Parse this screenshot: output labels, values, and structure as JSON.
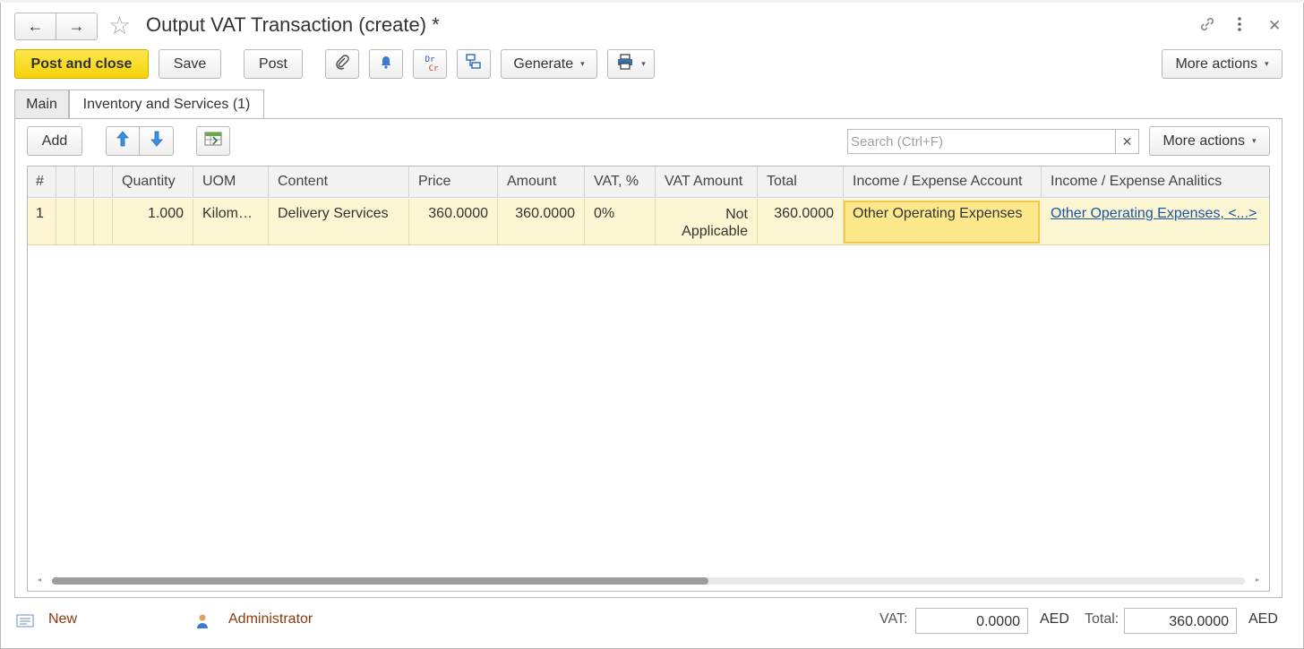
{
  "window": {
    "title": "Output VAT Transaction (create) *"
  },
  "toolbar": {
    "post_close": "Post and close",
    "save": "Save",
    "post": "Post",
    "drcr_top": "Dr",
    "drcr_bottom": "Cr",
    "generate": "Generate",
    "more_actions": "More actions"
  },
  "tabs": [
    {
      "label": "Main"
    },
    {
      "label": "Inventory and Services (1)"
    }
  ],
  "table_toolbar": {
    "add": "Add",
    "search_placeholder": "Search (Ctrl+F)",
    "more_actions": "More actions"
  },
  "table": {
    "columns": [
      "#",
      "",
      "",
      "Quantity",
      "UOM",
      "Content",
      "Price",
      "Amount",
      "VAT, %",
      "VAT Amount",
      "Total",
      "Income / Expense Account",
      "Income / Expense Analitics"
    ],
    "rows": [
      {
        "num": "1",
        "quantity": "1.000",
        "uom": "Kilom…",
        "content": "Delivery Services",
        "price": "360.0000",
        "amount": "360.0000",
        "vat_percent": "0%",
        "vat_amount": "Not Applicable",
        "total": "360.0000",
        "account": "Other Operating Expenses",
        "analitics": "Other Operating Expenses, <...>"
      }
    ]
  },
  "scrollbar": {
    "position": 0.0,
    "visible_fraction": 0.55
  },
  "footer": {
    "status": "New",
    "user": "Administrator",
    "vat_label": "VAT:",
    "vat_value": "0.0000",
    "currency1": "AED",
    "total_label": "Total:",
    "total_value": "360.0000",
    "currency2": "AED"
  },
  "colors": {
    "primary_button": "#f6d10c",
    "selected_row": "#fdf6d2",
    "selected_cell": "#fde98c",
    "link": "#1a55a8",
    "footer_text": "#8a3a0d"
  }
}
